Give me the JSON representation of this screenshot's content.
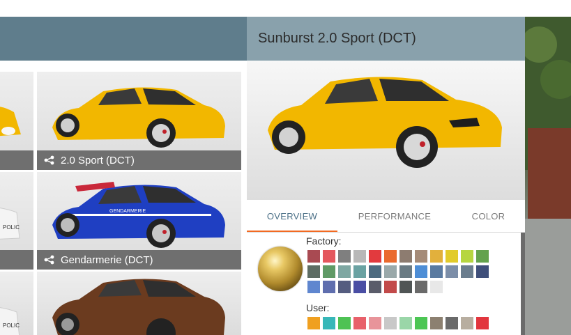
{
  "detail": {
    "title": "Sunburst 2.0 Sport (DCT)",
    "tabs": [
      {
        "label": "OVERVIEW",
        "active": true
      },
      {
        "label": "PERFORMANCE",
        "active": false
      },
      {
        "label": "COLOR",
        "active": false
      }
    ],
    "factory_label": "Factory:",
    "user_label": "User:",
    "selected_paint": "gold",
    "factory_colors": [
      "#a94a52",
      "#e4585e",
      "#7f7f7f",
      "#b8b8b8",
      "#e23a3e",
      "#ea6a2e",
      "#8d7c70",
      "#a58b78",
      "#e2b03c",
      "#e2cb2a",
      "#b6d640",
      "#63a24c",
      "#5d6c63",
      "#5f9a66",
      "#7ea7a2",
      "#6aa2a2",
      "#4d6b80",
      "#9aa9aa",
      "#6a7b84",
      "#4e8ed6",
      "#5a7aa0",
      "#7c8ea8",
      "#6a7d8e",
      "#3f4f7a",
      "#5f86cf",
      "#5f6eae",
      "#555d80",
      "#4a4ea4",
      "#5a5c6a",
      "#c24a4a",
      "#505555",
      "#6a6a6a",
      "#e8e8e8"
    ],
    "user_colors": [
      "#f0a020",
      "#37b7b8",
      "#4ec254",
      "#e8606a",
      "#e8949a",
      "#c8c8c8",
      "#9ad6a8",
      "#4cc654",
      "#8c8070",
      "#6a6a6a",
      "#b8aea0",
      "#e2363e"
    ]
  },
  "grid": {
    "tiles": [
      {
        "label": "2.0 Sport (DCT)",
        "body_color": "#f2b700"
      },
      {
        "label": "Gendarmerie (DCT)",
        "body_color": "#1f3fc2"
      },
      {
        "label": "",
        "body_color": "#6b3b1f"
      }
    ],
    "left_tiles_color": [
      "#f2b700",
      "#f4f4f4",
      "#f4f4f4"
    ],
    "police_text": "POLIC",
    "gendarmerie_text": "GENDARMERIE"
  },
  "icons": {
    "config": "share-nodes-icon"
  }
}
